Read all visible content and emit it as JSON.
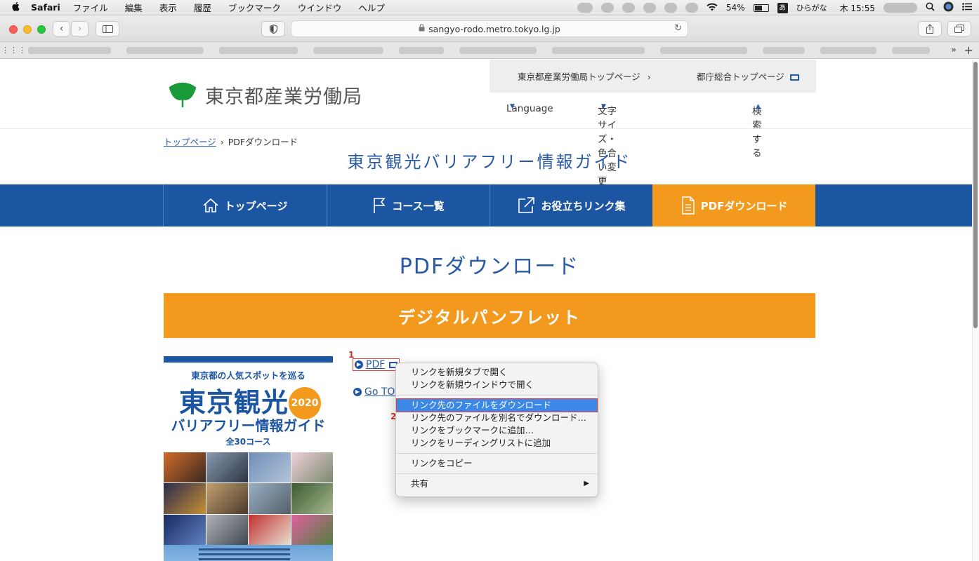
{
  "menubar": {
    "app_name": "Safari",
    "items": [
      "ファイル",
      "編集",
      "表示",
      "履歴",
      "ブックマーク",
      "ウインドウ",
      "ヘルプ"
    ],
    "battery": "54%",
    "input_method": "ひらがな",
    "ime_glyph": "あ",
    "clock": "木 15:55"
  },
  "browser": {
    "url": "sangyo-rodo.metro.tokyo.lg.jp"
  },
  "site": {
    "logo_text": "東京都産業労働局",
    "top_links": [
      {
        "label": "東京都産業労働局トップページ",
        "suffix": "›"
      },
      {
        "label": "都庁総合トップページ"
      }
    ],
    "util_nav": [
      "Language",
      "文字サイズ・色合い変更",
      "検索する"
    ],
    "breadcrumb": {
      "home": "トップページ",
      "separator": "›",
      "current": "PDFダウンロード"
    },
    "title": "東京観光バリアフリー情報ガイド",
    "nav": [
      {
        "label": "トップページ",
        "icon": "home-icon"
      },
      {
        "label": "コース一覧",
        "icon": "flag-icon"
      },
      {
        "label": "お役立ちリンク集",
        "icon": "external-link-icon"
      },
      {
        "label": "PDFダウンロード",
        "icon": "document-icon",
        "active": true
      }
    ],
    "accent": "#1c56a2",
    "orange": "#f39a1e"
  },
  "main": {
    "heading": "PDFダウンロード",
    "section_title": "デジタルパンフレット",
    "cover": {
      "line1": "東京都の人気スポットを巡る",
      "line2": "東京観光",
      "year": "2020",
      "line3": "バリアフリー情報ガイド",
      "line4": "全30コース"
    },
    "pdf_link": "PDF",
    "goto_link": "Go TO",
    "step_markers": [
      "1",
      "2"
    ]
  },
  "context_menu": {
    "groups": [
      [
        "リンクを新規タブで開く",
        "リンクを新規ウインドウで開く"
      ],
      [
        "リンク先のファイルをダウンロード",
        "リンク先のファイルを別名でダウンロード…",
        "リンクをブックマークに追加…",
        "リンクをリーディングリストに追加"
      ],
      [
        "リンクをコピー"
      ],
      [
        "共有"
      ]
    ],
    "highlighted": "リンク先のファイルをダウンロード",
    "submenu_arrow": "▶"
  }
}
